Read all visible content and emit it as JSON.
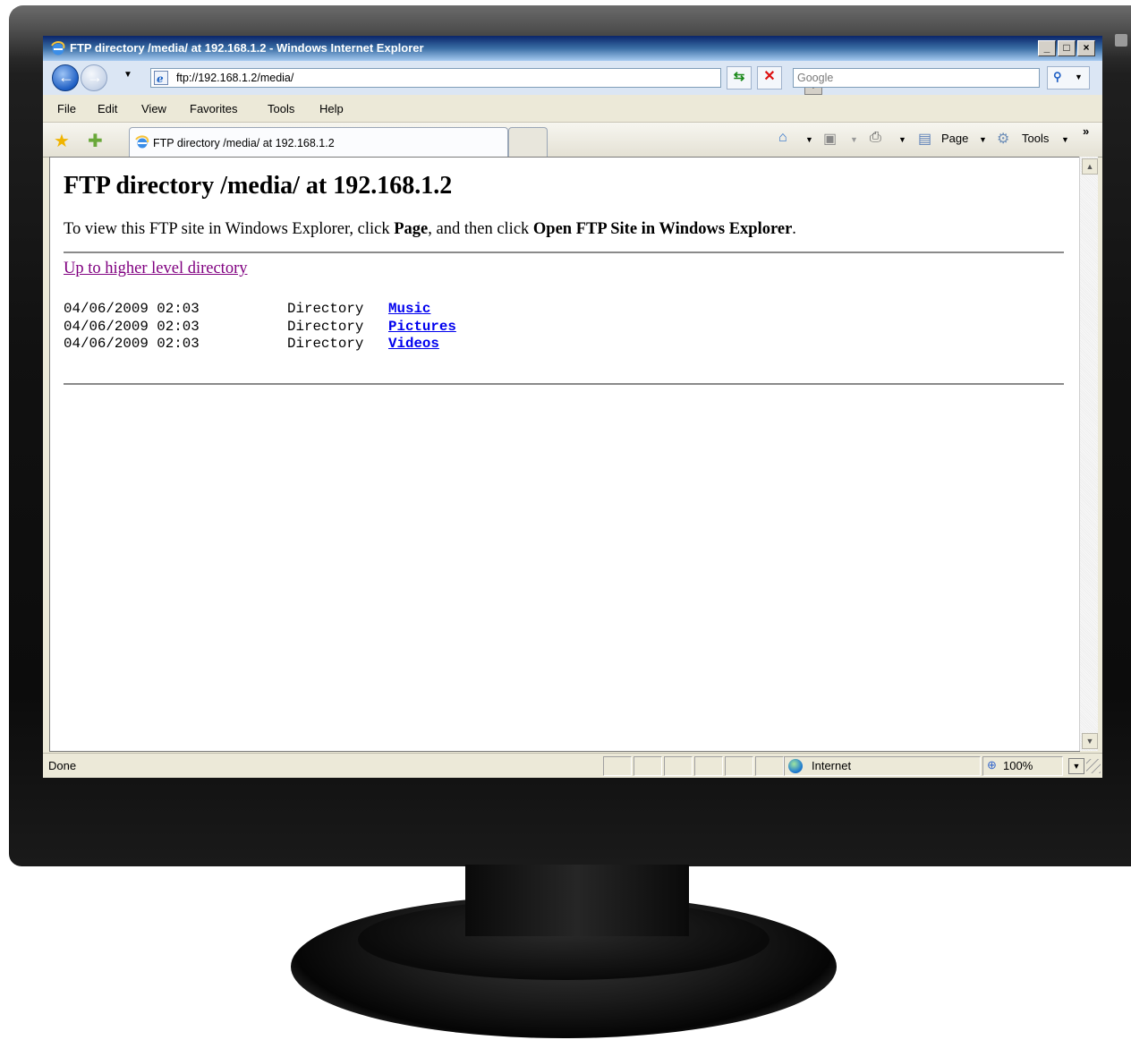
{
  "window": {
    "title": "FTP directory /media/ at 192.168.1.2 - Windows Internet Explorer",
    "minimize_glyph": "_",
    "maximize_glyph": "□",
    "close_glyph": "×"
  },
  "navbar": {
    "back_glyph": "←",
    "forward_glyph": "→",
    "address": "ftp://192.168.1.2/media/",
    "search_placeholder": "Google"
  },
  "menu": [
    "File",
    "Edit",
    "View",
    "Favorites",
    "Tools",
    "Help"
  ],
  "tab": {
    "label": "FTP directory /media/ at 192.168.1.2"
  },
  "commands": {
    "page_label": "Page",
    "tools_label": "Tools",
    "more_glyph": "»"
  },
  "page": {
    "heading": "FTP directory /media/ at 192.168.1.2",
    "intro_prefix": "To view this FTP site in Windows Explorer, click ",
    "intro_page": "Page",
    "intro_middle": ", and then click ",
    "intro_open": "Open FTP Site in Windows Explorer",
    "intro_suffix": ".",
    "up_link": "Up to higher level directory",
    "entries": [
      {
        "date": "04/06/2009 02:03",
        "type": "Directory",
        "name": "Music"
      },
      {
        "date": "04/06/2009 02:03",
        "type": "Directory",
        "name": "Pictures"
      },
      {
        "date": "04/06/2009 02:03",
        "type": "Directory",
        "name": "Videos"
      }
    ]
  },
  "status": {
    "text": "Done",
    "zone": "Internet",
    "zoom": "100%"
  },
  "icons": {
    "ie": "ie-logo-icon",
    "back": "back-arrow-icon",
    "forward": "forward-arrow-icon",
    "refresh": "refresh-icon",
    "stop": "stop-icon",
    "search": "magnifier-icon",
    "favorites": "star-icon",
    "add_favorite": "add-star-icon",
    "home": "home-icon",
    "feeds": "rss-icon",
    "print": "printer-icon",
    "page": "page-icon",
    "tools": "gear-icon",
    "zone": "globe-icon",
    "zoom": "zoom-icon"
  },
  "colors": {
    "link": "#0000ee",
    "visited_link": "#800080",
    "title_bar": "#0a246a"
  }
}
